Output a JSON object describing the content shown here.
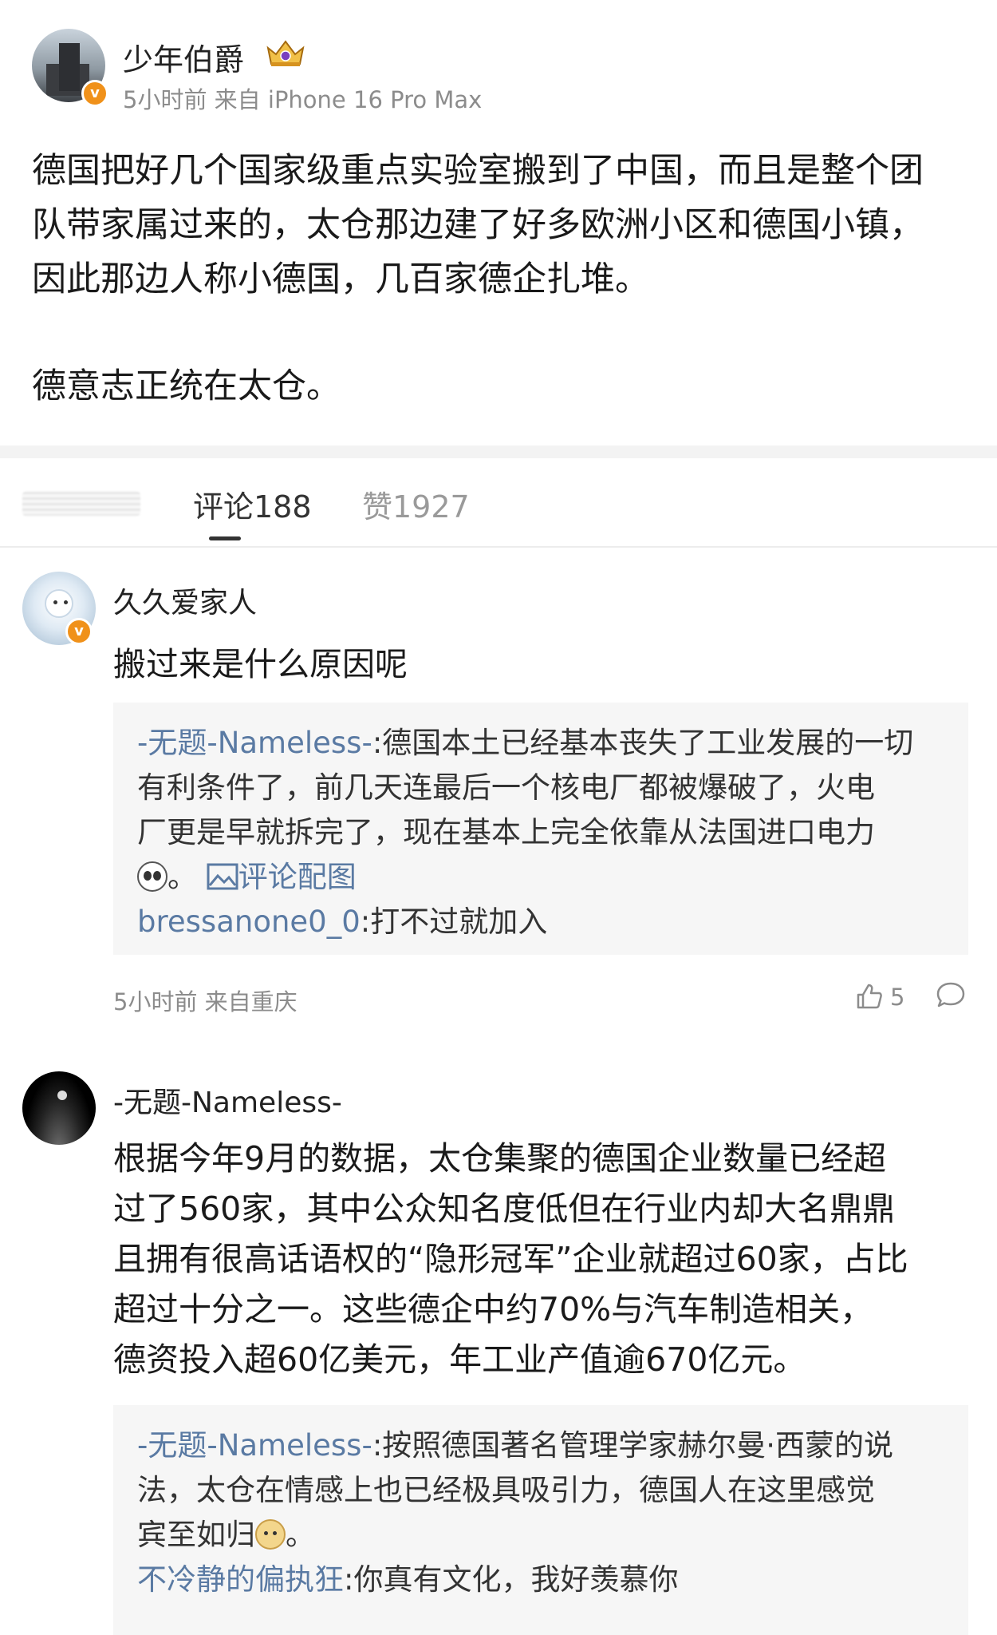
{
  "post": {
    "author": "少年伯爵",
    "meta": "5小时前 来自 iPhone 16 Pro Max",
    "verified_badge": "v",
    "paragraphs": [
      "德国把好几个国家级重点实验室搬到了中国，而且是整个团",
      "队带家属过来的，太仓那边建了好多欧洲小区和德国小镇，",
      "因此那边人称小德国，几百家德企扎堆。",
      "德意志正统在太仓。"
    ]
  },
  "tabs": {
    "comments": "评论188",
    "likes": "赞1927"
  },
  "comments": [
    {
      "user": "久久爱家人",
      "text": "搬过来是什么原因呢",
      "replies": {
        "r1_user": "-无题-Nameless-",
        "r1_line1": ":德国本土已经基本丧失了工业发展的一切",
        "r1_line2": "有利条件了，前几天连最后一个核电厂都被爆破了，火电",
        "r1_line3": "厂更是早就拆完了，现在基本上完全依靠从法国进口电力",
        "r1_line4_suffix": "。",
        "r1_image_link": "评论配图",
        "r2_user": "bressanone0_0",
        "r2_text": ":打不过就加入"
      },
      "meta": "5小时前 来自重庆",
      "likes": "5"
    },
    {
      "user": "-无题-Nameless-",
      "lines": [
        "根据今年9月的数据，太仓集聚的德国企业数量已经超",
        "过了560家，其中公众知名度低但在行业内却大名鼎鼎",
        "且拥有很高话语权的“隐形冠军”企业就超过60家，占比",
        "超过十分之一。这些德企中约70%与汽车制造相关，",
        "德资投入超60亿美元，年工业产值逾670亿元。"
      ],
      "replies": {
        "r1_user": "-无题-Nameless-",
        "r1_line1": ":按照德国著名管理学家赫尔曼·西蒙的说",
        "r1_line2": "法，太仓在情感上也已经极具吸引力，德国人在这里感觉",
        "r1_line3": "宾至如归",
        "r1_line3_suffix": "。",
        "r2_user": "不冷静的偏执狂",
        "r2_text": ":你真有文化，我好羡慕你"
      }
    }
  ],
  "colors": {
    "reply_user": "#5a7aa3",
    "badge": "#f0911a",
    "meta_gray": "#8c8c8c",
    "reply_bg": "#f6f6f6"
  }
}
